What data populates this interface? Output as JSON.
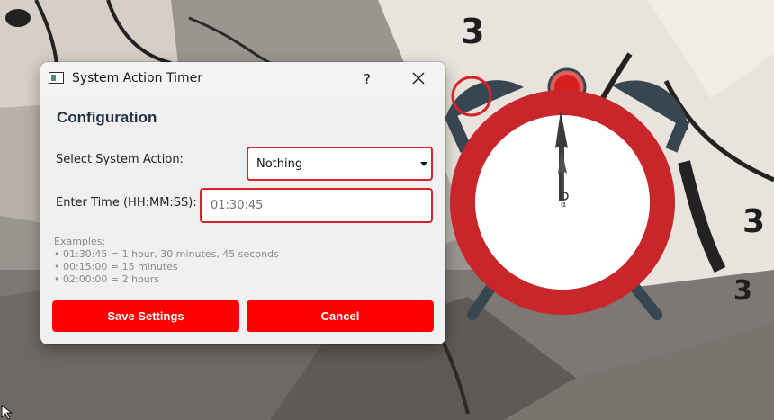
{
  "dialog": {
    "title": "System Action Timer",
    "help_label": "?",
    "section_title": "Configuration",
    "action_label": "Select System Action:",
    "action_value": "Nothing",
    "time_label": "Enter Time (HH:MM:SS):",
    "time_placeholder": "01:30:45",
    "examples": [
      "Examples:",
      "• 01:30:45 = 1 hour, 30 minutes, 45 seconds",
      "• 00:15:00 = 15 minutes",
      "• 02:00:00 = 2 hours"
    ],
    "save_label": "Save Settings",
    "cancel_label": "Cancel"
  },
  "colors": {
    "accent_red": "#d9232b",
    "button_red": "#ff0000",
    "clock_ring": "#c8262b",
    "clock_bells": "#374650"
  },
  "icons": [
    "app-window-icon",
    "close-icon",
    "dropdown-arrow-icon",
    "alarm-clock-icon"
  ],
  "background": {
    "wallpaper_digits": [
      "3",
      "3",
      "3"
    ]
  }
}
